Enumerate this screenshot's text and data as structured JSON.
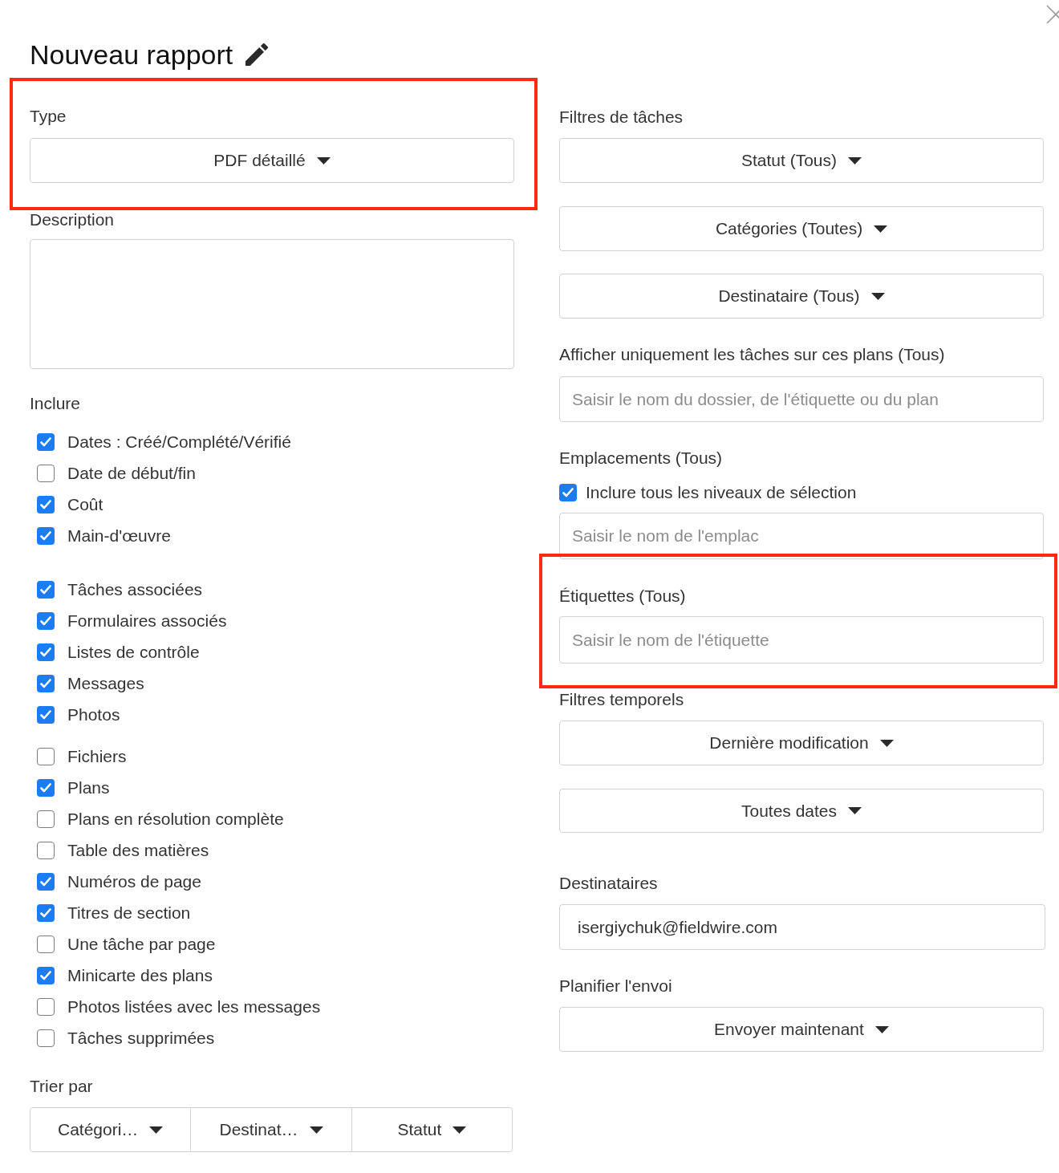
{
  "dialog": {
    "title": "Nouveau rapport"
  },
  "type": {
    "label": "Type",
    "value": "PDF détaillé",
    "highlighted": true
  },
  "description": {
    "label": "Description"
  },
  "include": {
    "label": "Inclure",
    "groups": [
      {
        "items": [
          {
            "label": "Dates : Créé/Complété/Vérifié",
            "checked": true
          },
          {
            "label": "Date de début/fin",
            "checked": false
          },
          {
            "label": "Coût",
            "checked": true
          },
          {
            "label": "Main-d'œuvre",
            "checked": true
          }
        ]
      },
      {
        "items": [
          {
            "label": "Tâches associées",
            "checked": true
          },
          {
            "label": "Formulaires associés",
            "checked": true
          },
          {
            "label": "Listes de contrôle",
            "checked": true
          },
          {
            "label": "Messages",
            "checked": true
          },
          {
            "label": "Photos",
            "checked": true
          }
        ]
      },
      {
        "items": [
          {
            "label": "Fichiers",
            "checked": false
          },
          {
            "label": "Plans",
            "checked": true
          },
          {
            "label": "Plans en résolution complète",
            "checked": false
          },
          {
            "label": "Table des matières",
            "checked": false
          },
          {
            "label": "Numéros de page",
            "checked": true
          },
          {
            "label": "Titres de section",
            "checked": true
          },
          {
            "label": "Une tâche par page",
            "checked": false
          },
          {
            "label": "Minicarte des plans",
            "checked": true
          },
          {
            "label": "Photos listées avec les messages",
            "checked": false
          },
          {
            "label": "Tâches supprimées",
            "checked": false
          }
        ]
      }
    ]
  },
  "sort": {
    "label": "Trier par",
    "options": [
      "Catégori…",
      "Destinat…",
      "Statut"
    ]
  },
  "task_filters": {
    "label": "Filtres de tâches",
    "dropdowns": [
      "Statut (Tous)",
      "Catégories (Toutes)",
      "Destinataire (Tous)"
    ]
  },
  "plans_filter": {
    "label": "Afficher uniquement les tâches sur ces plans (Tous)",
    "placeholder": "Saisir le nom du dossier, de l'étiquette ou du plan"
  },
  "locations": {
    "label": "Emplacements (Tous)",
    "include_all_levels": {
      "label": "Inclure tous les niveaux de sélection",
      "checked": true
    },
    "placeholder": "Saisir le nom de l'emplac"
  },
  "tags": {
    "label": "Étiquettes (Tous)",
    "placeholder": "Saisir le nom de l'étiquette",
    "highlighted": true
  },
  "time_filters": {
    "label": "Filtres temporels",
    "dropdowns": [
      "Dernière modification",
      "Toutes dates"
    ]
  },
  "recipients": {
    "label": "Destinataires",
    "value": "isergiychuk@fieldwire.com"
  },
  "schedule": {
    "label": "Planifier l'envoi",
    "value": "Envoyer maintenant"
  }
}
